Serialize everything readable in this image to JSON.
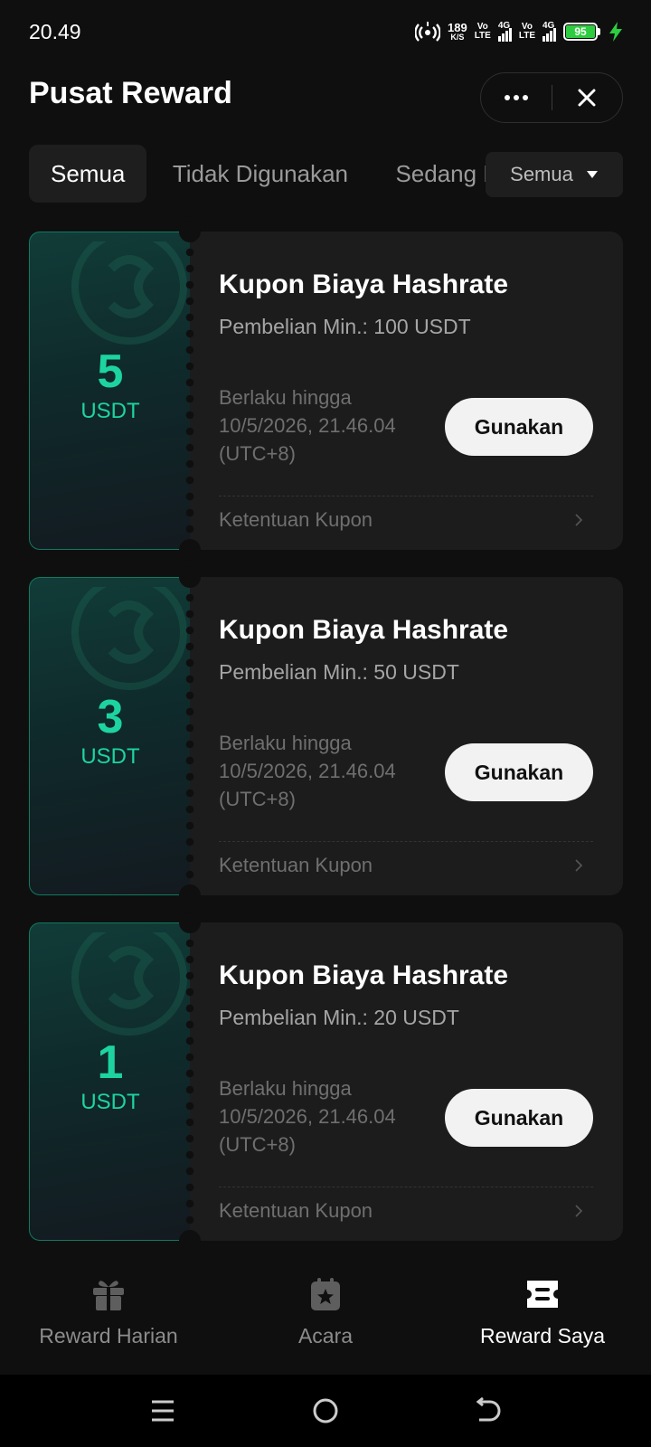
{
  "status_bar": {
    "time": "20.49",
    "net_speed": "189",
    "net_speed_unit": "K/S",
    "volte_1": [
      "Vo",
      "LTE"
    ],
    "volte_2": [
      "Vo",
      "LTE"
    ],
    "sig_1": "4G",
    "sig_2": "4G",
    "battery": "95"
  },
  "header": {
    "title": "Pusat Reward"
  },
  "tabs": [
    {
      "label": "Semua",
      "active": true
    },
    {
      "label": "Tidak Digunakan",
      "active": false
    },
    {
      "label": "Sedang Digunakan",
      "active": false
    }
  ],
  "filter": {
    "label": "Semua"
  },
  "coupons": [
    {
      "value": "5",
      "unit": "USDT",
      "title": "Kupon Biaya Hashrate",
      "min": "Pembelian Min.: 100 USDT",
      "valid_label": "Berlaku hingga",
      "valid_date": "10/5/2026, 21.46.04",
      "valid_tz": "(UTC+8)",
      "use_label": "Gunakan",
      "terms_label": "Ketentuan Kupon"
    },
    {
      "value": "3",
      "unit": "USDT",
      "title": "Kupon Biaya Hashrate",
      "min": "Pembelian Min.: 50 USDT",
      "valid_label": "Berlaku hingga",
      "valid_date": "10/5/2026, 21.46.04",
      "valid_tz": "(UTC+8)",
      "use_label": "Gunakan",
      "terms_label": "Ketentuan Kupon"
    },
    {
      "value": "1",
      "unit": "USDT",
      "title": "Kupon Biaya Hashrate",
      "min": "Pembelian Min.: 20 USDT",
      "valid_label": "Berlaku hingga",
      "valid_date": "10/5/2026, 21.46.04",
      "valid_tz": "(UTC+8)",
      "use_label": "Gunakan",
      "terms_label": "Ketentuan Kupon"
    }
  ],
  "bottom_nav": [
    {
      "label": "Reward Harian",
      "icon": "gift-icon",
      "active": false
    },
    {
      "label": "Acara",
      "icon": "calendar-star-icon",
      "active": false
    },
    {
      "label": "Reward Saya",
      "icon": "ticket-icon",
      "active": true
    }
  ],
  "colors": {
    "accent": "#1dd4a0",
    "background": "#0f0f0f",
    "card": "#1c1c1c",
    "battery": "#2ecc40"
  }
}
